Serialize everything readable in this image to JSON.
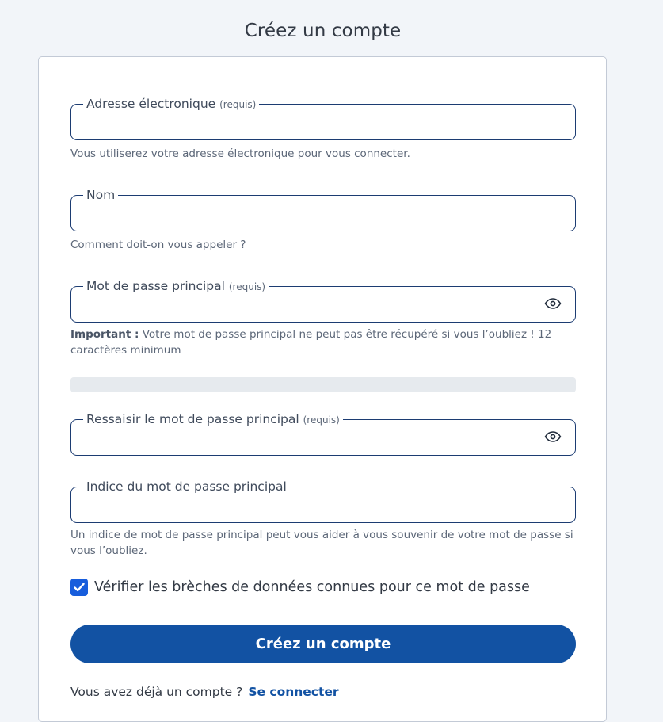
{
  "page": {
    "title": "Créez un compte"
  },
  "form": {
    "email": {
      "label": "Adresse électronique",
      "required": "(requis)",
      "value": "",
      "hint": "Vous utiliserez votre adresse électronique pour vous connecter."
    },
    "name": {
      "label": "Nom",
      "value": "",
      "hint": "Comment doit-on vous appeler ?"
    },
    "master_password": {
      "label": "Mot de passe principal",
      "required": "(requis)",
      "value": "",
      "hint_strong": "Important :",
      "hint_text": " Votre mot de passe principal ne peut pas être récupéré si vous l’oubliez ! 12 caractères minimum",
      "toggle_icon": "eye-icon"
    },
    "password_strength": {
      "level": 0
    },
    "confirm_password": {
      "label": "Ressaisir le mot de passe principal",
      "required": "(requis)",
      "value": "",
      "toggle_icon": "eye-icon"
    },
    "password_hint": {
      "label": "Indice du mot de passe principal",
      "value": "",
      "hint": "Un indice de mot de passe principal peut vous aider à vous souvenir de votre mot de passe si vous l’oubliez."
    },
    "breach_check": {
      "label": "Vérifier les brèches de données connues pour ce mot de passe",
      "checked": true
    },
    "submit_label": "Créez un compte",
    "login_prompt": "Vous avez déjà un compte ?",
    "login_link": "Se connecter"
  },
  "colors": {
    "primary": "#1252a3",
    "checkbox": "#175ddc",
    "field_border": "#1c3c72",
    "background": "#f2f5f9"
  }
}
